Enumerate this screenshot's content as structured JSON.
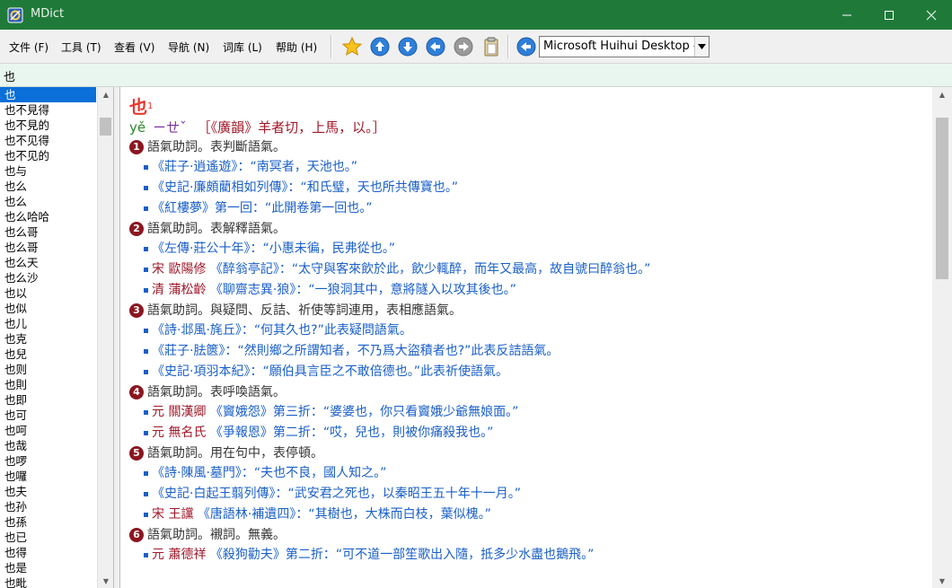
{
  "window": {
    "title": "MDict"
  },
  "menu": [
    "文件 (F)",
    "工具 (T)",
    "查看 (V)",
    "导航 (N)",
    "词库 (L)",
    "帮助 (H)"
  ],
  "toolbar": {
    "icons": [
      "star-icon",
      "arrow-up-icon",
      "arrow-down-icon",
      "arrow-left-icon",
      "arrow-right-icon",
      "clipboard-icon",
      "speaker-back-icon"
    ],
    "dictionary": "Microsoft Huihui Desktop - C"
  },
  "search": {
    "value": "也"
  },
  "word_list": [
    "也",
    "也不見得",
    "也不見的",
    "也不见得",
    "也不见的",
    "也与",
    "也么",
    "也么",
    "也么哈哈",
    "也么哥",
    "也么哥",
    "也么天",
    "也么沙",
    "也以",
    "也似",
    "也儿",
    "也克",
    "也兒",
    "也则",
    "也則",
    "也即",
    "也可",
    "也呵",
    "也哉",
    "也啰",
    "也囉",
    "也夫",
    "也孙",
    "也孫",
    "也已",
    "也得",
    "也是",
    "也毗"
  ],
  "selected_index": 0,
  "entry": {
    "headword": "也",
    "sup": "1",
    "pinyin": "yě",
    "zhuyin": "ㄧㄝˇ",
    "fanqie": "［《廣韻》羊者切，上馬，以。］",
    "senses": [
      {
        "num": "1",
        "text": "語氣助詞。表判斷語氣。",
        "examples": [
          {
            "auth": "",
            "src": "《莊子·逍遙遊》：",
            "quote": "“南冥者，天池也。”"
          },
          {
            "auth": "",
            "src": "《史記·廉頗藺相如列傳》：",
            "quote": "“和氏璧，天也所共傳寶也。”"
          },
          {
            "auth": "",
            "src": "《紅樓夢》第一回：",
            "quote": "“此開卷第一回也。”"
          }
        ]
      },
      {
        "num": "2",
        "text": "語氣助詞。表解釋語氣。",
        "examples": [
          {
            "auth": "",
            "src": "《左傳·莊公十年》：",
            "quote": "“小惠未徧，民弗從也。”"
          },
          {
            "auth": "宋 歐陽修",
            "src": "《醉翁亭記》：",
            "quote": "“太守與客來飲於此，飲少輒醉，而年又最高，故自號曰醉翁也。”"
          },
          {
            "auth": "清 蒲松齡",
            "src": "《聊齋志異·狼》：",
            "quote": "“一狼洞其中，意將隧入以攻其後也。”"
          }
        ]
      },
      {
        "num": "3",
        "text": "語氣助詞。與疑問、反詰、祈使等詞連用，表相應語氣。",
        "examples": [
          {
            "auth": "",
            "src": "《詩·邶風·旄丘》：",
            "quote": "“何其久也?”此表疑問語氣。"
          },
          {
            "auth": "",
            "src": "《莊子·胠篋》：",
            "quote": "“然則鄉之所謂知者，不乃爲大盜積者也?”此表反詰語氣。"
          },
          {
            "auth": "",
            "src": "《史記·項羽本紀》：",
            "quote": "“願伯具言臣之不敢倍德也。”此表祈使語氣。"
          }
        ]
      },
      {
        "num": "4",
        "text": "語氣助詞。表呼喚語氣。",
        "examples": [
          {
            "auth": "元 關漢卿",
            "src": "《竇娥怨》第三折：",
            "quote": "“婆婆也，你只看竇娥少爺無娘面。”"
          },
          {
            "auth": "元 無名氏",
            "src": "《爭報恩》第二折：",
            "quote": "“哎，兒也，則被你痛殺我也。”"
          }
        ]
      },
      {
        "num": "5",
        "text": "語氣助詞。用在句中，表停頓。",
        "examples": [
          {
            "auth": "",
            "src": "《詩·陳風·墓門》：",
            "quote": "“夫也不良，國人知之。”"
          },
          {
            "auth": "",
            "src": "《史記·白起王翦列傳》：",
            "quote": "“武安君之死也，以秦昭王五十年十一月。”"
          },
          {
            "auth": "宋 王讜",
            "src": "《唐語林·補遺四》：",
            "quote": "“其樹也，大株而白枝，葉似槐。”"
          }
        ]
      },
      {
        "num": "6",
        "text": "語氣助詞。襯詞。無義。",
        "examples": [
          {
            "auth": "元 蕭德祥",
            "src": "《殺狗勸夫》第二折：",
            "quote": "“可不道一部笙歌出入隨，抵多少水盡也鵝飛。”"
          }
        ]
      }
    ]
  }
}
